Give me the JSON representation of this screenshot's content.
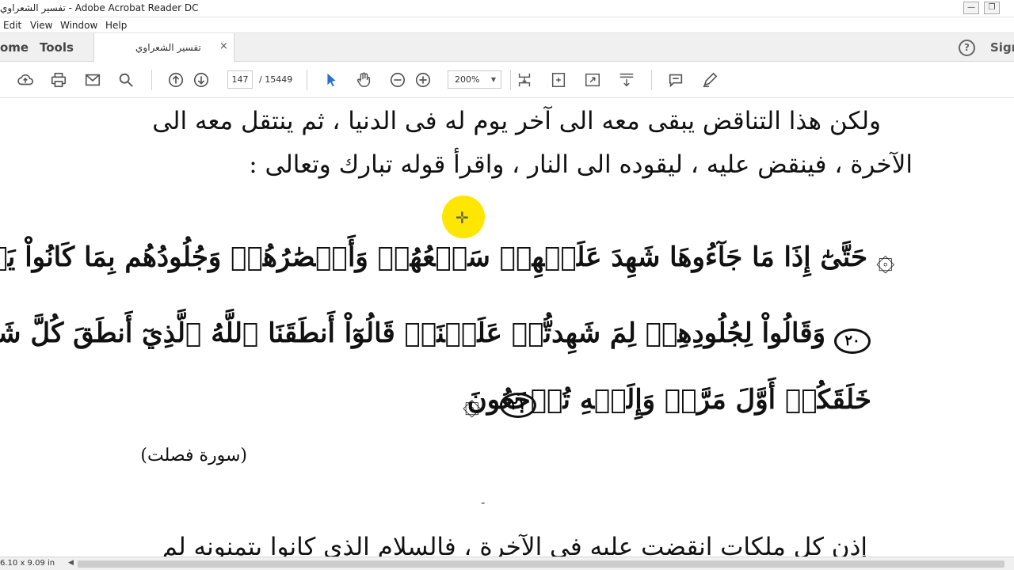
{
  "window": {
    "title": "تفسير الشعراوي - Adobe Acrobat Reader DC",
    "minimize": "—",
    "restore": "❐"
  },
  "menu": [
    "Edit",
    "View",
    "Window",
    "Help"
  ],
  "tabs": {
    "home": "ome",
    "tools": "Tools",
    "document": "تفسير الشعراوي",
    "close": "×",
    "help": "?",
    "sign": "Sign"
  },
  "toolbar": {
    "page_current": "147",
    "page_total": "/ 15449",
    "zoom": "200%"
  },
  "document": {
    "line1": "ولكن هذا التناقض يبقى معه الى آخر يوم له فى الدنيا ، ثم ينتقل معه الى",
    "line2": "الآخرة ، فينقض عليه ، ليقوده الى النار ، واقرأ قوله تبارك وتعالى :",
    "verse1": "حَتَّىٰٓ إِذَا مَا جَآءُوهَا شَهِدَ عَلَيۡهِمۡ سَمۡعُهُمۡ وَأَبۡصَٰرُهُمۡ وَجُلُودُهُم بِمَا كَانُواْ يَعۡمَلُونَ",
    "verse1_num": "٢٠",
    "verse2": "وَقَالُواْ لِجُلُودِهِمۡ لِمَ شَهِدتُّمۡ عَلَيۡنَاۖ قَالُوٓاْ أَنطَقَنَا ٱللَّهُ ٱلَّذِيٓ أَنطَقَ كُلَّ شَيۡءٖ وَهُوَ",
    "verse3": "خَلَقَكُمۡ أَوَّلَ مَرَّةٖ وَإِلَيۡهِ تُرۡجَعُونَ",
    "verse3_num": "٢١",
    "surah": "(سورة فصلت)",
    "bottom_line": "إذن كل ملكات انقضت عليه في الآخرة ، فالسلام الذى كانوا يتمنونه لم"
  },
  "status": {
    "dims": "6.10 x 9.09 in"
  }
}
